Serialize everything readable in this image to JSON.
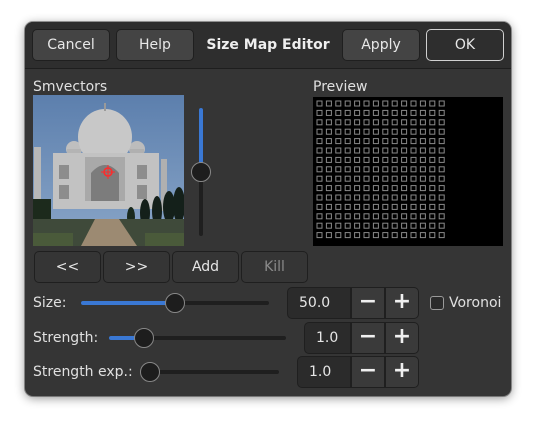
{
  "header": {
    "cancel_label": "Cancel",
    "help_label": "Help",
    "title": "Size Map Editor",
    "apply_label": "Apply",
    "ok_label": "OK"
  },
  "left_panel": {
    "label": "Smvectors",
    "image_description_icon": "taj-mahal-photo",
    "vertical_slider_value": 0.5
  },
  "preview": {
    "label": "Preview",
    "grid_columns": 14,
    "grid_rows": 15
  },
  "nav_buttons": {
    "prev_label": "<<",
    "next_label": ">>",
    "add_label": "Add",
    "kill_label": "Kill"
  },
  "controls": {
    "size": {
      "label": "Size:",
      "value": "50.0",
      "slider_fraction": 0.5
    },
    "strength": {
      "label": "Strength:",
      "value": "1.0",
      "slider_fraction": 0.2
    },
    "strength_exp": {
      "label": "Strength exp.:",
      "value": "1.0",
      "slider_fraction": 0.05
    },
    "voronoi_label": "Voronoi",
    "voronoi_checked": false
  },
  "spin": {
    "minus_glyph": "−",
    "plus_glyph": "+"
  },
  "colors": {
    "accent": "#3a78d4",
    "background": "#353535",
    "marker": "#ff2a2a"
  }
}
